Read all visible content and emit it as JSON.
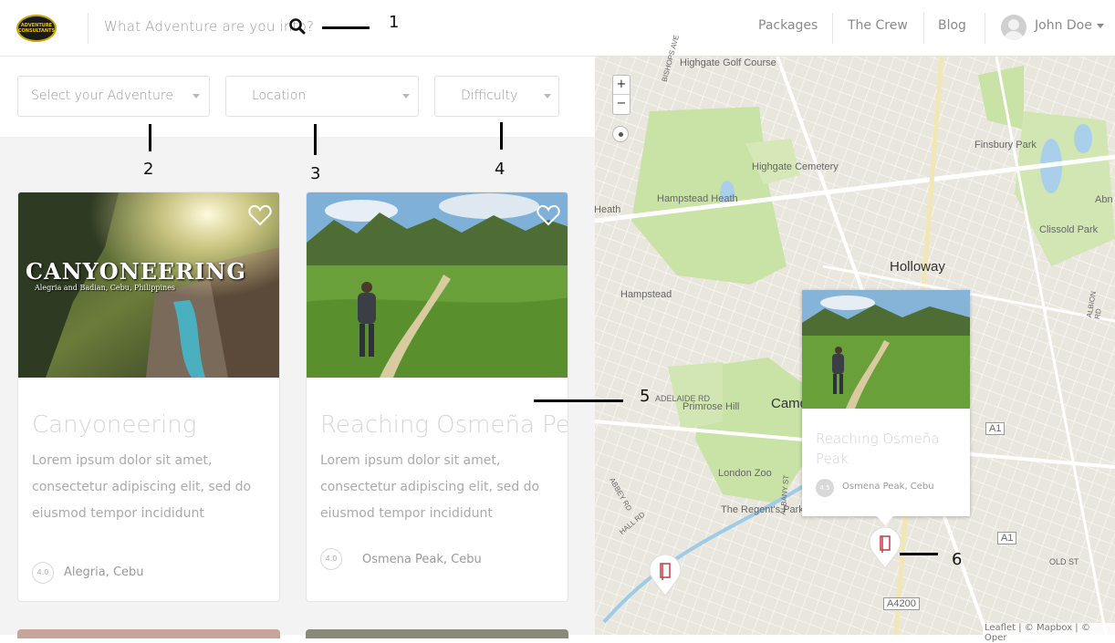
{
  "logo": {
    "line1": "ADVENTURE",
    "line2": "CONSULTANTS"
  },
  "search": {
    "placeholder": "What Adventure are you into?"
  },
  "nav": {
    "packages": "Packages",
    "crew": "The Crew",
    "blog": "Blog",
    "user": "John Doe"
  },
  "filters": {
    "adventure": "Select your Adventure",
    "location": "Location",
    "difficulty": "Difficulty"
  },
  "cards": [
    {
      "overlay_title": "CANYONEERING",
      "overlay_sub": "Alegria and Badian, Cebu, Philippines",
      "title": "Canyoneering",
      "desc": "Lorem ipsum dolor sit amet, consectetur adipiscing elit, sed do eiusmod tempor incididunt",
      "rating": "4.0",
      "location": "Alegria, Cebu"
    },
    {
      "title": "Reaching Osmeña Peak",
      "desc": "Lorem ipsum dolor sit amet, consectetur adipiscing elit, sed do eiusmod tempor incididunt",
      "rating": "4.0",
      "location": "Osmena Peak, Cebu"
    }
  ],
  "map": {
    "labels": [
      "Highgate Golf Course",
      "Highgate Cemetery",
      "Hampstead Heath",
      "Heath",
      "Hampstead",
      "Holloway",
      "Finsbury Park",
      "Clissold Park",
      "Primrose Hill",
      "London Zoo",
      "The Regent's Park",
      "Camd",
      "Abn",
      "A1",
      "A1",
      "A4200",
      "ADELAIDE RD",
      "OLD ST",
      "BISHOPS AVE",
      "ALBION RD",
      "ALBANY ST",
      "HALL RD",
      "ABBEY RD"
    ],
    "zoom_in": "+",
    "zoom_out": "−",
    "attribution": "Leaflet | © Mapbox | © Oper",
    "popup": {
      "title": "Reaching Osmeña Peak",
      "rating": "4.5",
      "location": "Osmena Peak, Cebu"
    }
  },
  "annotations": [
    "1",
    "2",
    "3",
    "4",
    "5",
    "6"
  ]
}
